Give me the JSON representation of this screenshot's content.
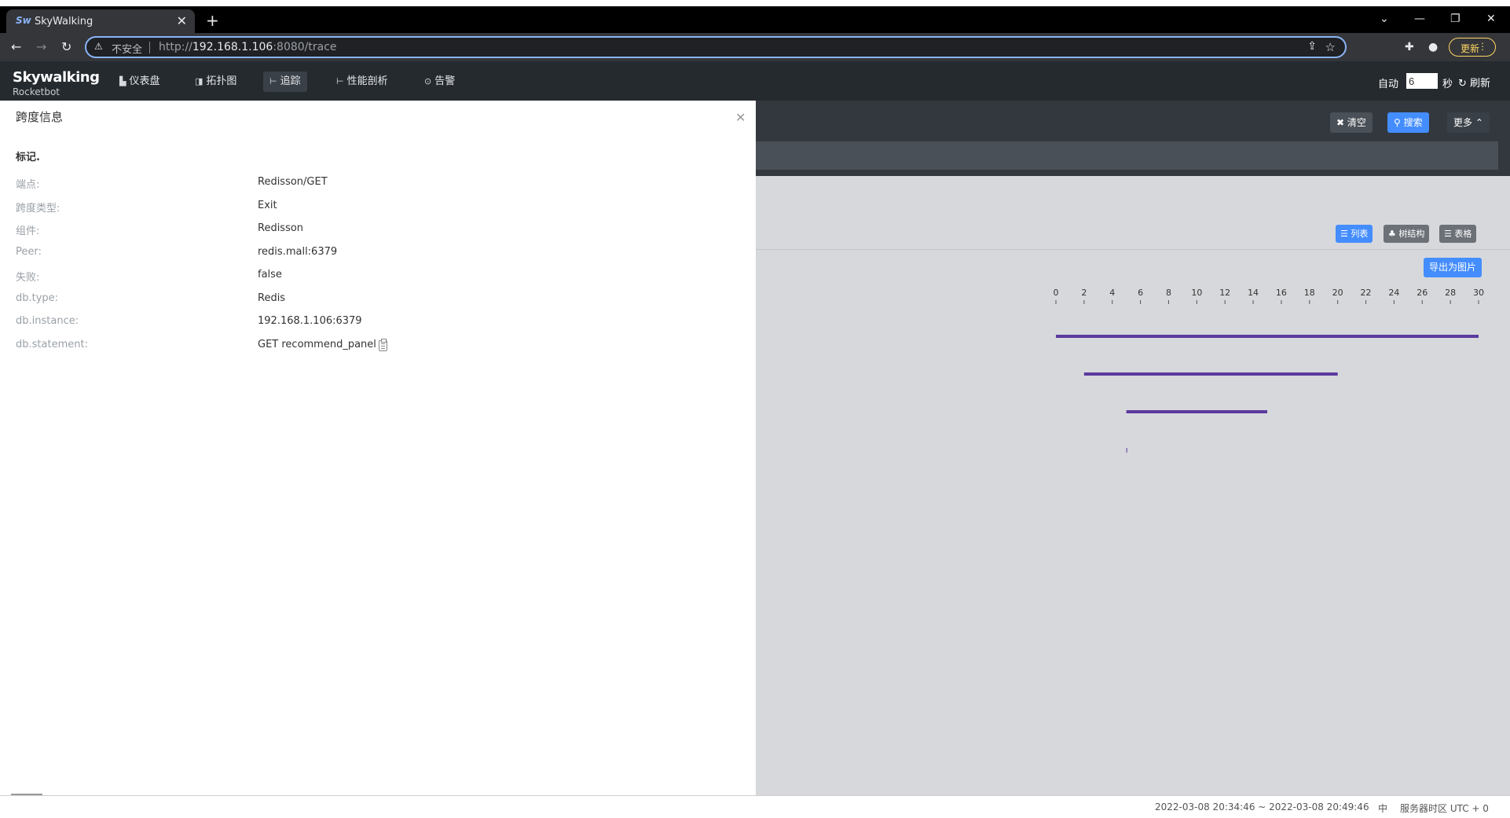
{
  "browser": {
    "tab_title": "SkyWalking",
    "favicon_text": "Sw",
    "insecure_label": "不安全",
    "url_prefix": "http://",
    "url_host": "192.168.1.106",
    "url_rest": ":8080/trace",
    "update_label": "更新"
  },
  "app": {
    "logo": "Skywalking",
    "logo_sub": "Rocketbot",
    "nav": [
      {
        "label": "仪表盘",
        "icon": "dashboard-icon"
      },
      {
        "label": "拓扑图",
        "icon": "topology-icon"
      },
      {
        "label": "追踪",
        "icon": "trace-icon"
      },
      {
        "label": "性能剖析",
        "icon": "profile-icon"
      },
      {
        "label": "告警",
        "icon": "alarm-icon"
      }
    ],
    "auto_label": "自动",
    "auto_interval": "6",
    "seconds_label": "秒",
    "refresh_label": "刷新"
  },
  "trace_toolbar": {
    "clear_label": "清空",
    "search_label": "搜索",
    "more_label": "更多"
  },
  "views": {
    "list_label": "列表",
    "tree_label": "树结构",
    "table_label": "表格",
    "export_label": "导出为图片"
  },
  "chart_data": {
    "type": "bar",
    "x_ticks": [
      "0",
      "2",
      "4",
      "6",
      "8",
      "10",
      "12",
      "14",
      "16",
      "18",
      "20",
      "22",
      "24",
      "26",
      "28",
      "30"
    ],
    "xlim": [
      0,
      30
    ],
    "spans": [
      {
        "start": 0,
        "end": 30
      },
      {
        "start": 2,
        "end": 20
      },
      {
        "start": 5,
        "end": 15
      },
      {
        "start": 5,
        "end": 5
      }
    ],
    "bar_color": "#5b3a9e"
  },
  "drawer": {
    "title": "跨度信息",
    "tags_heading": "标记.",
    "rows": [
      {
        "key": "端点:",
        "value": "Redisson/GET"
      },
      {
        "key": "跨度类型:",
        "value": "Exit"
      },
      {
        "key": "组件:",
        "value": "Redisson"
      },
      {
        "key": "Peer:",
        "value": "redis.mall:6379"
      },
      {
        "key": "失败:",
        "value": "false"
      },
      {
        "key": "db.type:",
        "value": "Redis"
      },
      {
        "key": "db.instance:",
        "value": "192.168.1.106:6379"
      },
      {
        "key": "db.statement:",
        "value": "GET recommend_panel"
      }
    ]
  },
  "footer": {
    "time_range": "2022-03-08 20:34:46 ~ 2022-03-08 20:49:46",
    "lang": "中",
    "timezone": "服务器时区 UTC + 0"
  }
}
